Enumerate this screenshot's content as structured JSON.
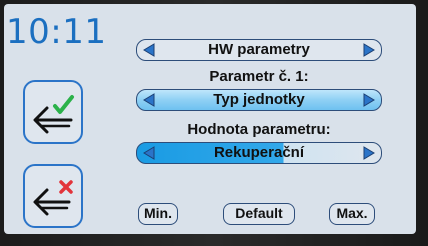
{
  "clock": "10:11",
  "menu": {
    "title": "HW parametry"
  },
  "parameter": {
    "caption": "Parametr č. 1:",
    "value": "Typ jednotky"
  },
  "parameter_value": {
    "caption": "Hodnota parametru:",
    "value": "Rekuperační",
    "level_percent": 60
  },
  "buttons": {
    "min": "Min.",
    "default": "Default",
    "max": "Max."
  },
  "side_buttons": {
    "confirm_icon": "back-arrow-check-icon",
    "cancel_icon": "back-arrow-cross-icon"
  },
  "colors": {
    "accent_blue": "#2b74c8",
    "check_green": "#2bb24a",
    "cross_red": "#e2343b",
    "clock_blue": "#1b6fc0"
  }
}
